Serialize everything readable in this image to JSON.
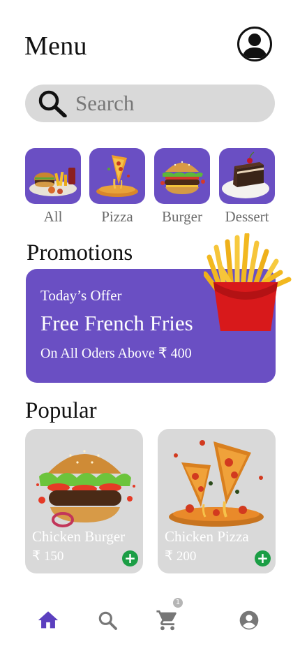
{
  "header": {
    "title": "Menu"
  },
  "search": {
    "placeholder": "Search"
  },
  "categories": [
    {
      "label": "All"
    },
    {
      "label": "Pizza"
    },
    {
      "label": "Burger"
    },
    {
      "label": "Dessert"
    }
  ],
  "promotions": {
    "heading": "Promotions",
    "tag": "Today’s Offer",
    "headline": "Free French Fries",
    "detail": "On All Oders Above ₹ 400"
  },
  "popular": {
    "heading": "Popular",
    "items": [
      {
        "name": "Chicken Burger",
        "price": "₹ 150"
      },
      {
        "name": "Chicken Pizza",
        "price": "₹ 200"
      }
    ]
  },
  "bottom_nav": {
    "items": [
      {
        "icon": "home-icon",
        "active": true
      },
      {
        "icon": "search-icon",
        "active": false
      },
      {
        "icon": "cart-icon",
        "active": false
      },
      {
        "icon": "account-icon",
        "active": false
      }
    ],
    "cart_count": "1"
  },
  "colors": {
    "accent": "#6a4fc3",
    "card_bg": "#d9d9d9",
    "add_button": "#1b9e45",
    "nav_active": "#5b3fbf",
    "nav_inactive": "#777777"
  }
}
